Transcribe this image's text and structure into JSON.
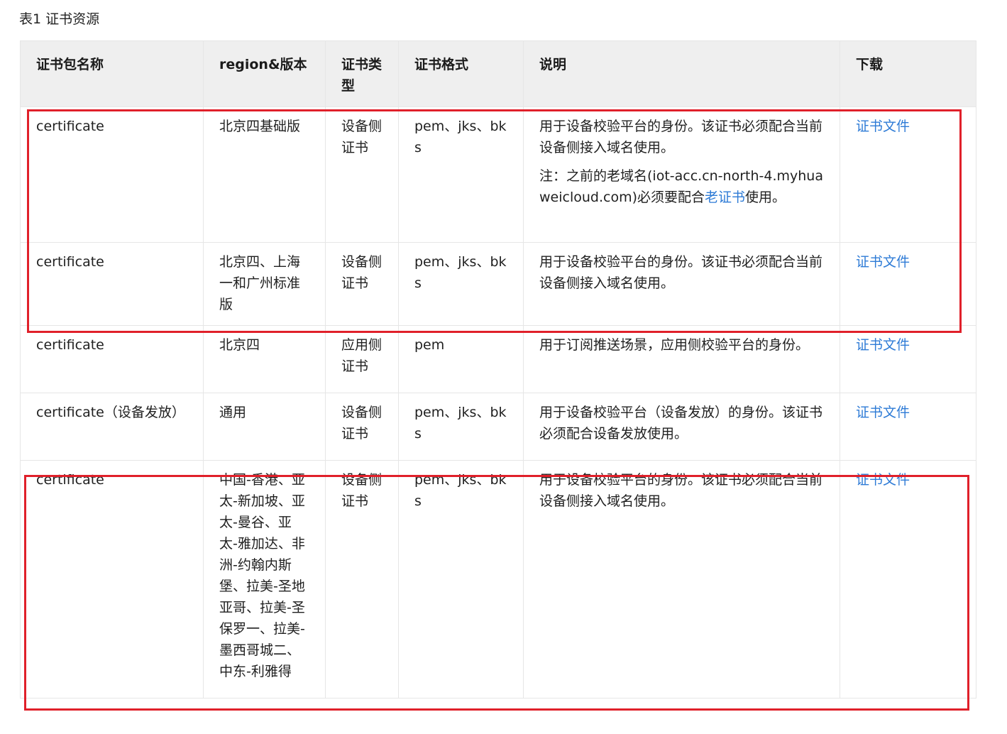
{
  "caption": "表1 证书资源",
  "table": {
    "headers": [
      "证书包名称",
      "region&版本",
      "证书类型",
      "证书格式",
      "说明",
      "下载"
    ],
    "rows": [
      {
        "name": "certificate",
        "region": "北京四基础版",
        "type": "设备侧证书",
        "format": "pem、jks、bks",
        "desc": "用于设备校验平台的身份。该证书必须配合当前设备侧接入域名使用。",
        "note_prefix": "注：之前的老域名(iot-acc.cn-north-4.myhuaweicloud.com)必须要配合",
        "note_link": "老证书",
        "note_suffix": "使用。",
        "download": "证书文件"
      },
      {
        "name": "certificate",
        "region": "北京四、上海一和广州标准版",
        "type": "设备侧证书",
        "format": "pem、jks、bks",
        "desc": "用于设备校验平台的身份。该证书必须配合当前设备侧接入域名使用。",
        "download": "证书文件"
      },
      {
        "name": "certificate",
        "region": "北京四",
        "type": "应用侧证书",
        "format": "pem",
        "desc": "用于订阅推送场景，应用侧校验平台的身份。",
        "download": "证书文件"
      },
      {
        "name": "certificate（设备发放）",
        "region": "通用",
        "type": "设备侧证书",
        "format": "pem、jks、bks",
        "desc": "用于设备校验平台（设备发放）的身份。该证书必须配合设备发放使用。",
        "download": "证书文件"
      },
      {
        "name": "certificate",
        "region": "中国-香港、亚太-新加坡、亚太-曼谷、亚太-雅加达、非洲-约翰内斯堡、拉美-圣地亚哥、拉美-圣保罗一、拉美-墨西哥城二、中东-利雅得",
        "type": "设备侧证书",
        "format": "pem、jks、bks",
        "desc": "用于设备校验平台的身份。该证书必须配合当前设备侧接入域名使用。",
        "download": "证书文件"
      }
    ]
  },
  "colors": {
    "link": "#2e7bd6",
    "highlight": "#e0202a",
    "header_bg": "#efefef",
    "border": "#e6e6e6"
  }
}
